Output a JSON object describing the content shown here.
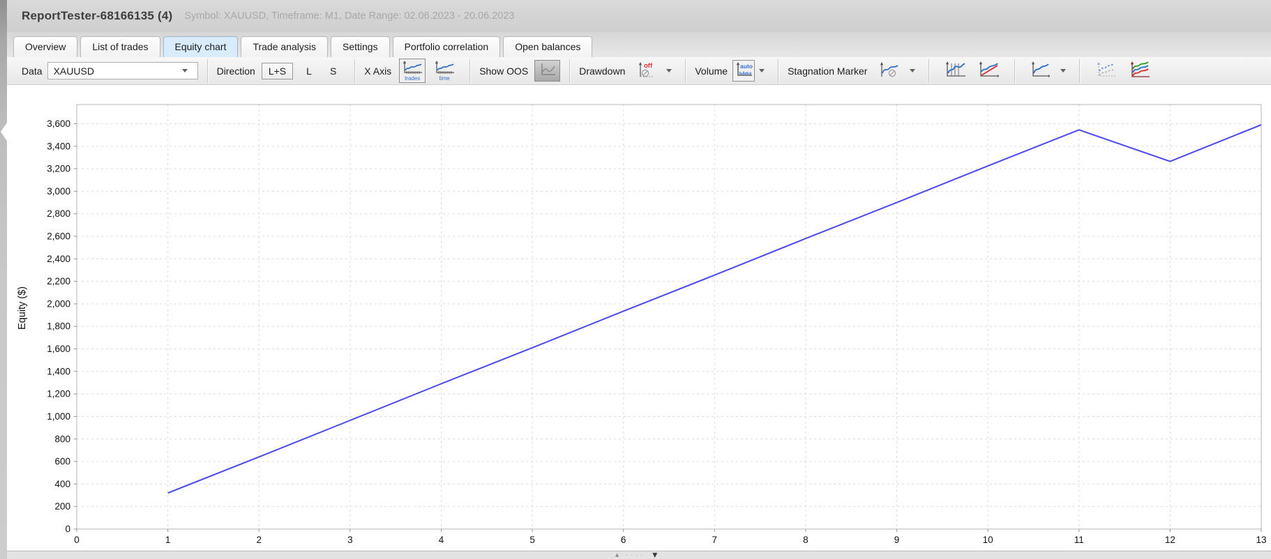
{
  "header": {
    "title": "ReportTester-68166135 (4)",
    "subtitle": "Symbol: XAUUSD, Timeframe: M1, Date Range: 02.06.2023 - 20.06.2023"
  },
  "tabs": {
    "items": [
      {
        "label": "Overview",
        "active": false
      },
      {
        "label": "List of trades",
        "active": false
      },
      {
        "label": "Equity chart",
        "active": true
      },
      {
        "label": "Trade analysis",
        "active": false
      },
      {
        "label": "Settings",
        "active": false
      },
      {
        "label": "Portfolio correlation",
        "active": false
      },
      {
        "label": "Open balances",
        "active": false
      }
    ]
  },
  "toolbar": {
    "data": {
      "label": "Data",
      "value": "XAUUSD"
    },
    "direction": {
      "label": "Direction",
      "options": [
        "L+S",
        "L",
        "S"
      ],
      "selected": "L+S"
    },
    "x_axis": {
      "label": "X Axis",
      "options": [
        "trades",
        "time"
      ],
      "selected": "trades"
    },
    "show_oos": {
      "label": "Show OOS"
    },
    "drawdown": {
      "label": "Drawdown",
      "state": "off"
    },
    "volume": {
      "label": "Volume",
      "state": "auto"
    },
    "stagnation_marker": {
      "label": "Stagnation Marker"
    }
  },
  "icons": {
    "pager_up": "▲",
    "pager_dots": "····",
    "pager_down": "▼"
  },
  "chart_data": {
    "type": "line",
    "title": "",
    "xlabel": "",
    "ylabel": "Equity ($)",
    "series_name": "Equity",
    "x": [
      1,
      2,
      3,
      4,
      5,
      6,
      7,
      8,
      9,
      10,
      11,
      12,
      13
    ],
    "values": [
      320,
      640,
      965,
      1290,
      1610,
      1935,
      2255,
      2580,
      2900,
      3225,
      3545,
      3265,
      3590
    ],
    "xlim": [
      0,
      13
    ],
    "ylim": [
      0,
      3770
    ],
    "x_ticks": [
      0,
      1,
      2,
      3,
      4,
      5,
      6,
      7,
      8,
      9,
      10,
      11,
      12,
      13
    ],
    "y_ticks": [
      0,
      200,
      400,
      600,
      800,
      1000,
      1200,
      1400,
      1600,
      1800,
      2000,
      2200,
      2400,
      2600,
      2800,
      3000,
      3200,
      3400,
      3600
    ],
    "grid": "dashed",
    "legend": "none",
    "line_color": "#4a49ec"
  }
}
